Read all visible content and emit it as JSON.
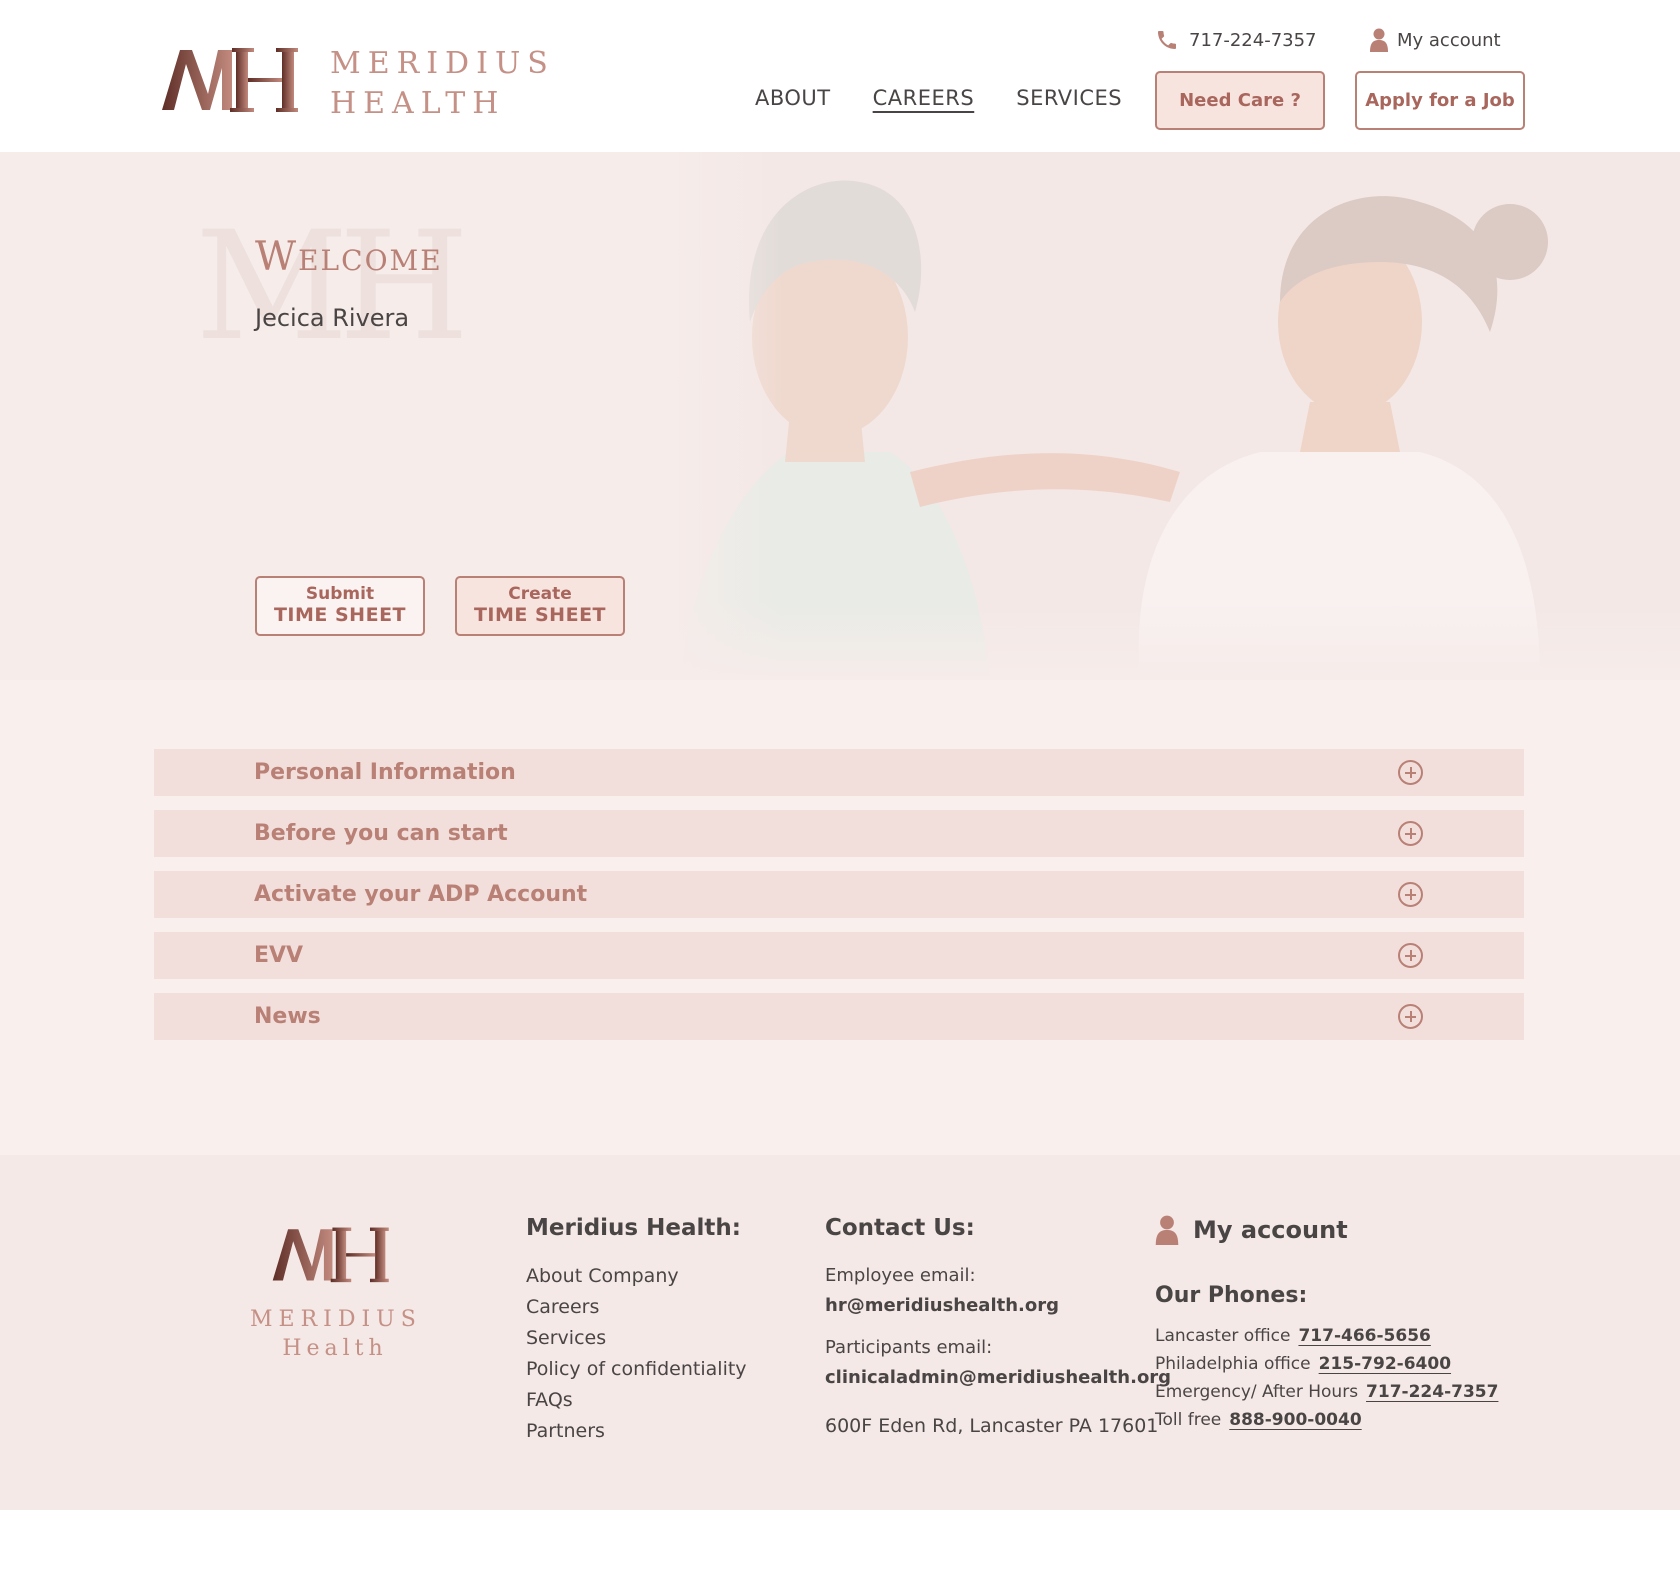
{
  "brand": {
    "line1": "MERIDIUS",
    "line2": "HEALTH",
    "monogram": "MH",
    "footer_line1": "MERIDIUS",
    "footer_line2": "Health"
  },
  "header": {
    "phone": "717-224-7357",
    "account_label": "My account",
    "nav": [
      {
        "label": "ABOUT"
      },
      {
        "label": "CAREERS"
      },
      {
        "label": "SERVICES"
      }
    ],
    "need_care_label": "Need Care ?",
    "apply_label": "Apply for a Job"
  },
  "hero": {
    "welcome": "Welcome",
    "user_name": "Jecica Rivera",
    "submit_small": "Submit",
    "submit_big": "TIME SHEET",
    "create_small": "Create",
    "create_big": "TIME SHEET"
  },
  "accordion": [
    {
      "label": "Personal Information"
    },
    {
      "label": "Before you can start"
    },
    {
      "label": "Activate your ADP Account"
    },
    {
      "label": "EVV"
    },
    {
      "label": "News"
    }
  ],
  "footer": {
    "company_heading": "Meridius Health:",
    "company_links": [
      {
        "label": "About Company"
      },
      {
        "label": "Careers"
      },
      {
        "label": "Services"
      },
      {
        "label": "Policy of confidentiality"
      },
      {
        "label": "FAQs"
      },
      {
        "label": "Partners"
      }
    ],
    "contact_heading": "Contact Us:",
    "employee_email_label": "Employee email:",
    "employee_email": "hr@meridiushealth.org",
    "participants_email_label": "Participants email:",
    "participants_email": "clinicaladmin@meridiushealth.org",
    "address": "600F Eden Rd, Lancaster PA 17601",
    "account_label": "My account",
    "phones_heading": "Our Phones:",
    "phones": [
      {
        "label": "Lancaster office",
        "number": "717-466-5656"
      },
      {
        "label": "Philadelphia office",
        "number": "215-792-6400"
      },
      {
        "label": "Emergency/ After Hours",
        "number": "717-224-7357"
      },
      {
        "label": "Toll free",
        "number": "888-900-0040"
      }
    ]
  },
  "colors": {
    "accent": "#b98076",
    "accent_text": "#a8665c",
    "hero_bg": "#f6ecea",
    "accordion_bg": "#f2dfdb",
    "footer_bg": "#f4e9e7",
    "logo_dark": "#6e3a31"
  }
}
